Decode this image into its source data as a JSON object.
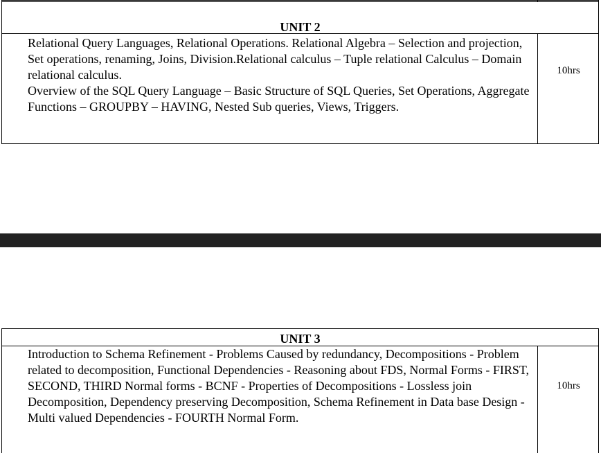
{
  "unit2": {
    "heading": "UNIT 2",
    "paragraphs": [
      "Relational Query Languages, Relational Operations. Relational Algebra – Selection and projection, Set operations, renaming, Joins, Division.Relational calculus – Tuple relational Calculus – Domain relational calculus.",
      "Overview of the SQL Query Language – Basic Structure of SQL Queries, Set Operations, Aggregate Functions – GROUPBY – HAVING, Nested Sub queries, Views, Triggers."
    ],
    "hours": "10hrs"
  },
  "unit3": {
    "heading": "UNIT 3",
    "paragraphs": [
      "Introduction to Schema Refinement - Problems Caused by redundancy, Decompositions - Problem related to decomposition, Functional Dependencies - Reasoning about FDS, Normal Forms - FIRST, SECOND, THIRD Normal forms - BCNF - Properties of Decompositions - Lossless join Decomposition, Dependency preserving Decomposition, Schema Refinement in Data base Design - Multi valued Dependencies - FOURTH Normal Form."
    ],
    "hours": "10hrs"
  },
  "colors": {
    "page_break_band": "#222222",
    "border": "#000000"
  }
}
